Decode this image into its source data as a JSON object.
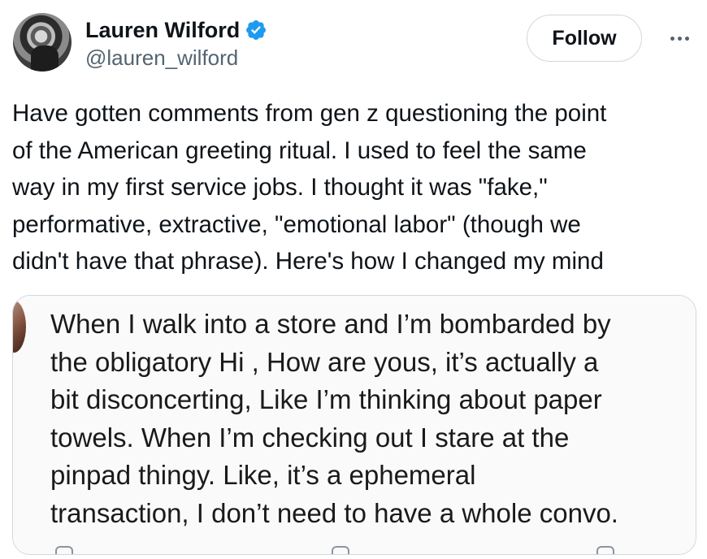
{
  "author": {
    "display_name": "Lauren Wilford",
    "handle": "@lauren_wilford",
    "verified": true,
    "verified_color": "#1d9bf0"
  },
  "actions": {
    "follow_label": "Follow",
    "more_icon": "more-horizontal-icon"
  },
  "tweet": {
    "text": "Have gotten comments from gen z questioning the point\nof the American greeting ritual. I used to feel the same\nway in my first service jobs. I thought it was \"fake,\"\nperformative, extractive, \"emotional labor\" (though we\ndidn't have that phrase). Here's how I changed my mind"
  },
  "quoted_image": {
    "text": "When I walk into a store and I’m bombarded by\nthe obligatory Hi , How are yous, it’s actually a\nbit disconcerting, Like I’m thinking about paper\ntowels. When I’m checking out I stare at the\npinpad thingy. Like, it’s a ephemeral\ntransaction, I don’t need to have a whole convo."
  }
}
